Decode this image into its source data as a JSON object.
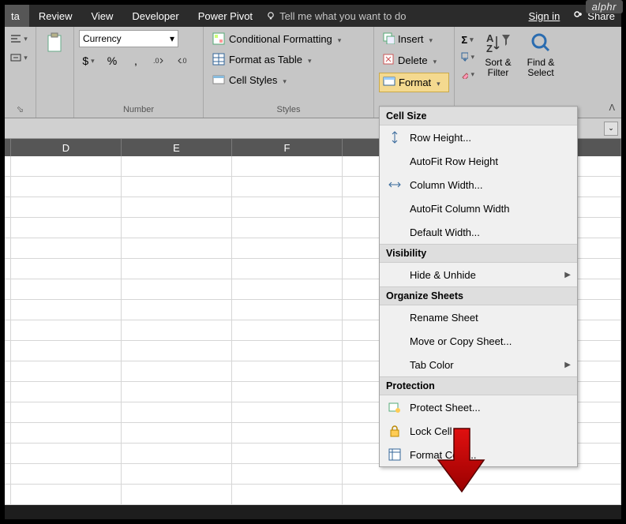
{
  "tabs": {
    "partial": "ta",
    "review": "Review",
    "view": "View",
    "developer": "Developer",
    "power_pivot": "Power Pivot",
    "tell_me": "Tell me what you want to do",
    "sign_in": "Sign in",
    "share": "Share"
  },
  "ribbon": {
    "number": {
      "label": "Number",
      "format": "Currency",
      "dollar": "$",
      "percent": "%",
      "comma": ","
    },
    "styles": {
      "label": "Styles",
      "cond_fmt": "Conditional Formatting",
      "as_table": "Format as Table",
      "cell_styles": "Cell Styles"
    },
    "cells": {
      "insert": "Insert",
      "delete": "Delete",
      "format": "Format"
    },
    "editing": {
      "sigma": "Σ",
      "sort": "Sort & Filter",
      "find": "Find & Select"
    }
  },
  "menu": {
    "section_cell_size": "Cell Size",
    "row_height": "Row Height...",
    "autofit_row": "AutoFit Row Height",
    "col_width": "Column Width...",
    "autofit_col": "AutoFit Column Width",
    "default_width": "Default Width...",
    "section_visibility": "Visibility",
    "hide_unhide": "Hide & Unhide",
    "section_organize": "Organize Sheets",
    "rename_sheet": "Rename Sheet",
    "move_copy": "Move or Copy Sheet...",
    "tab_color": "Tab Color",
    "section_protection": "Protection",
    "protect_sheet": "Protect Sheet...",
    "lock_cell": "Lock Cell",
    "format_cells": "Format Cells..."
  },
  "columns": {
    "D": "D",
    "E": "E",
    "F": "F"
  },
  "badge": "alphr"
}
